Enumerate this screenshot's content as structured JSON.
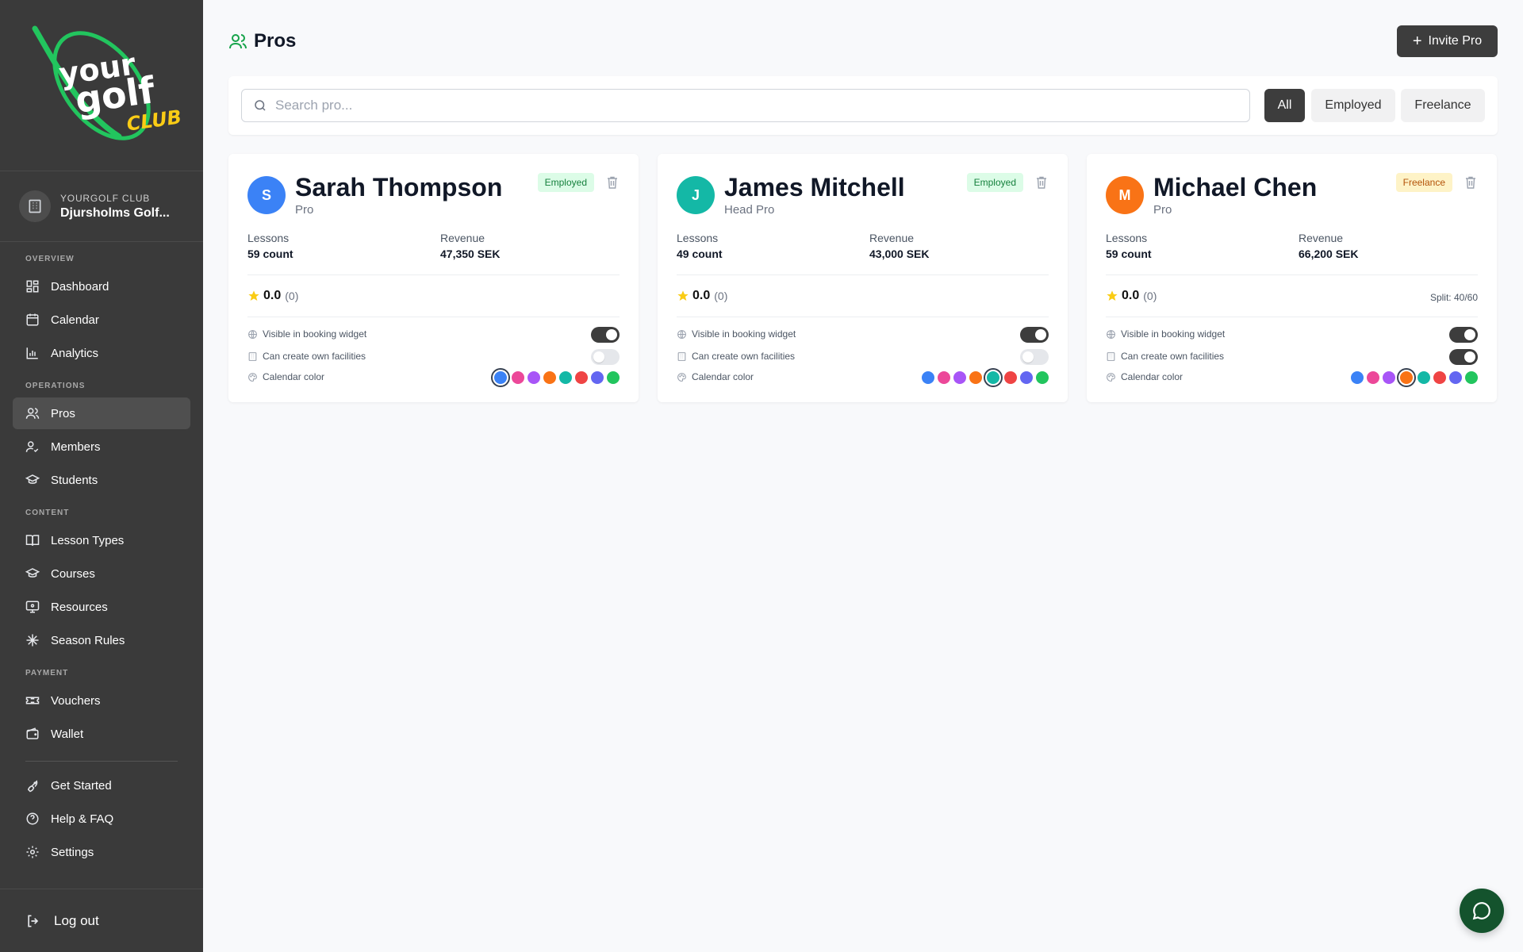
{
  "brand": {
    "logo_word1": "your",
    "logo_word2": "golf",
    "logo_word3": "CLUB",
    "logo_green": "#22c55e",
    "logo_yellow": "#facc15"
  },
  "club": {
    "label": "YOURGOLF CLUB",
    "name": "Djursholms Golf..."
  },
  "sidebar": {
    "sections": [
      {
        "title": "OVERVIEW",
        "items": [
          {
            "label": "Dashboard",
            "icon": "dashboard-icon"
          },
          {
            "label": "Calendar",
            "icon": "calendar-icon"
          },
          {
            "label": "Analytics",
            "icon": "analytics-icon"
          }
        ]
      },
      {
        "title": "OPERATIONS",
        "items": [
          {
            "label": "Pros",
            "icon": "users-icon",
            "active": true
          },
          {
            "label": "Members",
            "icon": "user-check-icon"
          },
          {
            "label": "Students",
            "icon": "graduation-cap-icon"
          }
        ]
      },
      {
        "title": "CONTENT",
        "items": [
          {
            "label": "Lesson Types",
            "icon": "book-icon"
          },
          {
            "label": "Courses",
            "icon": "graduation-cap-icon"
          },
          {
            "label": "Resources",
            "icon": "monitor-icon"
          },
          {
            "label": "Season Rules",
            "icon": "snowflake-icon"
          }
        ]
      },
      {
        "title": "PAYMENT",
        "items": [
          {
            "label": "Vouchers",
            "icon": "ticket-icon"
          },
          {
            "label": "Wallet",
            "icon": "wallet-icon"
          }
        ]
      }
    ],
    "footer_items": [
      {
        "label": "Get Started",
        "icon": "rocket-icon"
      },
      {
        "label": "Help & FAQ",
        "icon": "help-circle-icon"
      },
      {
        "label": "Settings",
        "icon": "gear-icon"
      }
    ],
    "logout_label": "Log out"
  },
  "header": {
    "title": "Pros",
    "invite_label": "Invite Pro"
  },
  "search": {
    "placeholder": "Search pro...",
    "value": ""
  },
  "filters": [
    {
      "label": "All",
      "active": true
    },
    {
      "label": "Employed",
      "active": false
    },
    {
      "label": "Freelance",
      "active": false
    }
  ],
  "labels": {
    "lessons": "Lessons",
    "revenue": "Revenue",
    "visible": "Visible in booking widget",
    "facilities": "Can create own facilities",
    "calendar_color": "Calendar color"
  },
  "pros": [
    {
      "initial": "S",
      "name": "Sarah Thompson",
      "role": "Pro",
      "badge": "Employed",
      "badge_type": "employed",
      "lessons": "59 count",
      "revenue": "47,350 SEK",
      "rating": "0.0",
      "rating_count": "(0)",
      "split": "",
      "visible_in_widget": true,
      "can_create_facilities": false,
      "avatar_color": "#3b82f6",
      "selected_color_index": 0
    },
    {
      "initial": "J",
      "name": "James Mitchell",
      "role": "Head Pro",
      "badge": "Employed",
      "badge_type": "employed",
      "lessons": "49 count",
      "revenue": "43,000 SEK",
      "rating": "0.0",
      "rating_count": "(0)",
      "split": "",
      "visible_in_widget": true,
      "can_create_facilities": false,
      "avatar_color": "#14b8a6",
      "selected_color_index": 4
    },
    {
      "initial": "M",
      "name": "Michael Chen",
      "role": "Pro",
      "badge": "Freelance",
      "badge_type": "freelance",
      "lessons": "59 count",
      "revenue": "66,200 SEK",
      "rating": "0.0",
      "rating_count": "(0)",
      "split": "Split: 40/60",
      "visible_in_widget": true,
      "can_create_facilities": true,
      "avatar_color": "#f97316",
      "selected_color_index": 3
    }
  ],
  "calendar_colors": [
    "#3b82f6",
    "#ec4899",
    "#a855f7",
    "#f97316",
    "#14b8a6",
    "#ef4444",
    "#6366f1",
    "#22c55e"
  ],
  "colors": {
    "sidebar_bg": "#3a3a3a",
    "accent_dark": "#3d3d3d",
    "star": "#facc15",
    "chat_button": "#14532d"
  }
}
